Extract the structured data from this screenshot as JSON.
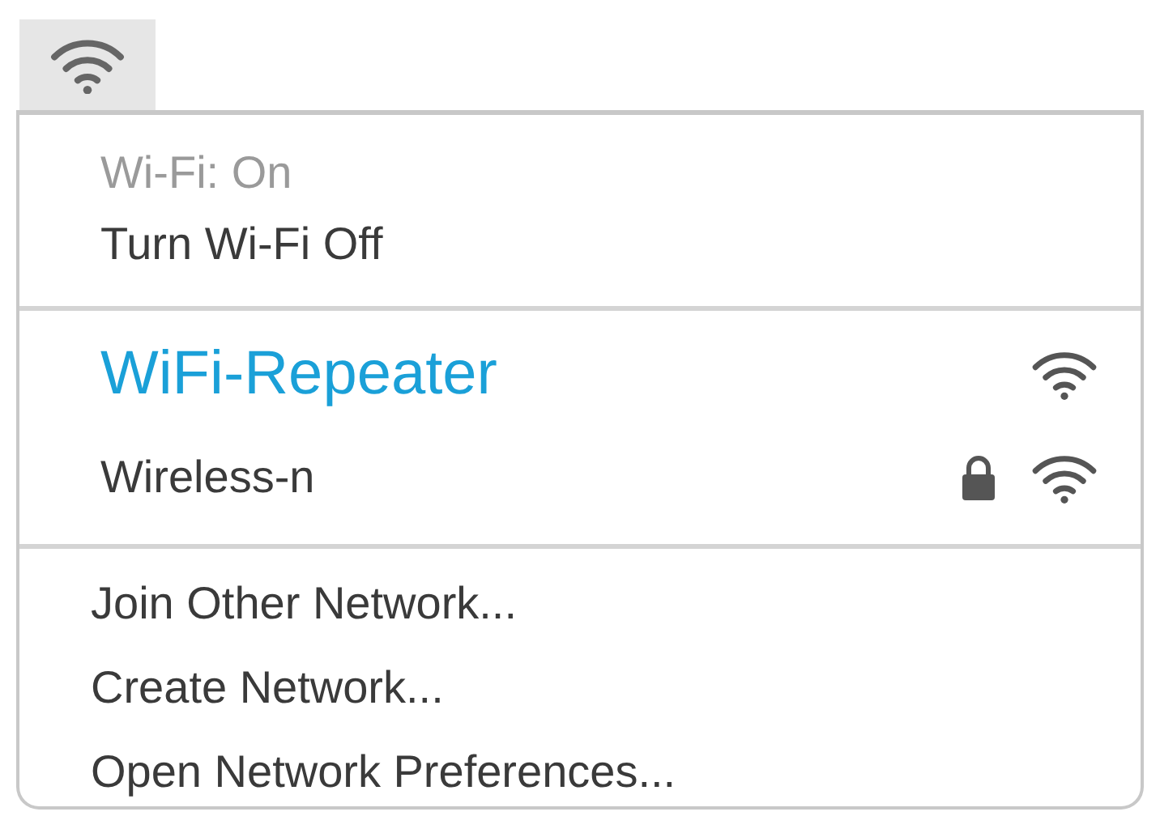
{
  "status": "Wi-Fi: On",
  "toggle": "Turn Wi-Fi Off",
  "networks": [
    {
      "name": "WiFi-Repeater",
      "selected": true,
      "locked": false
    },
    {
      "name": "Wireless-n",
      "selected": false,
      "locked": true
    }
  ],
  "actions": [
    "Join Other Network...",
    "Create Network...",
    "Open Network Preferences..."
  ]
}
